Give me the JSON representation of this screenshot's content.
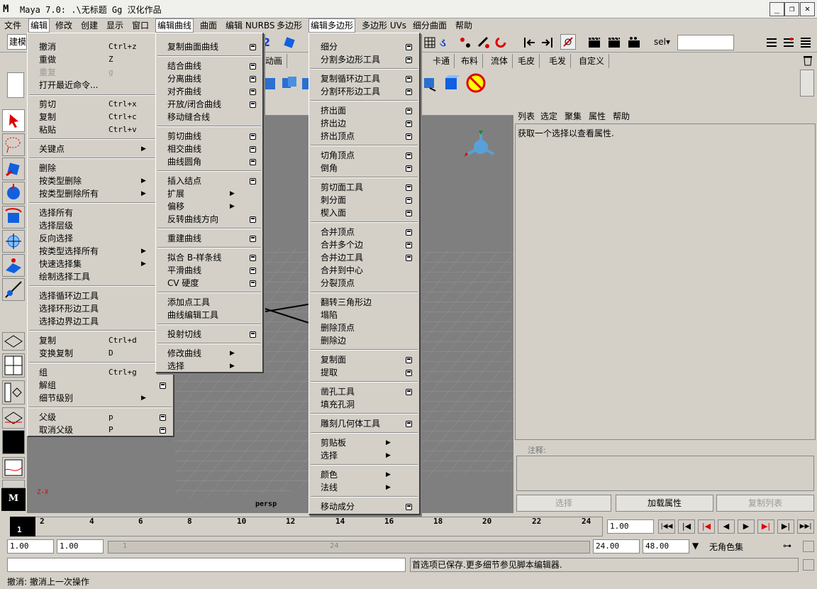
{
  "window": {
    "title": "Maya 7.0: .\\无标题 Gg 汉化作品",
    "minimize": "_",
    "maximize": "❐",
    "close": "✕"
  },
  "menubar": [
    "文件",
    "编辑",
    "修改",
    "创建",
    "显示",
    "窗口",
    "编辑曲线",
    "曲面",
    "编辑 NURBS",
    "多边形",
    "编辑多边形",
    "多边形 UVs",
    "细分曲面",
    "帮助"
  ],
  "toolbar": {
    "mode_dropdown": "建模",
    "sel_label": "sel▾",
    "sel_value": ""
  },
  "shelf_tabs": [
    "动画",
    "卡通",
    "布料",
    "流体",
    "毛皮",
    "毛发",
    "自定义"
  ],
  "viewport": {
    "camera_label": "persp",
    "axis_label": "Z-X"
  },
  "attribute_panel": {
    "menu": [
      "列表",
      "选定",
      "聚集",
      "属性",
      "帮助"
    ],
    "message": "获取一个选择以查看属性.",
    "notes_label": "注释:",
    "buttons": {
      "select": "选择",
      "load": "加载属性",
      "copy_tab": "复制列表"
    }
  },
  "edit_menu": {
    "items": [
      {
        "label": "撤消",
        "shortcut": "Ctrl+z"
      },
      {
        "label": "重做",
        "shortcut": "Z"
      },
      {
        "label": "重复",
        "shortcut": "g",
        "disabled": true
      },
      {
        "label": "打开最近命令..."
      },
      {
        "label": "剪切",
        "shortcut": "Ctrl+x"
      },
      {
        "label": "复制",
        "shortcut": "Ctrl+c"
      },
      {
        "label": "粘贴",
        "shortcut": "Ctrl+v"
      },
      {
        "label": "关键点"
      },
      {
        "label": "删除"
      },
      {
        "label": "按类型删除"
      },
      {
        "label": "按类型删除所有"
      },
      {
        "label": "选择所有"
      },
      {
        "label": "选择层级"
      },
      {
        "label": "反向选择"
      },
      {
        "label": "按类型选择所有"
      },
      {
        "label": "快速选择集"
      },
      {
        "label": "绘制选择工具"
      },
      {
        "label": "选择循环边工具"
      },
      {
        "label": "选择环形边工具"
      },
      {
        "label": "选择边界边工具"
      },
      {
        "label": "复制",
        "shortcut": "Ctrl+d"
      },
      {
        "label": "变换复制",
        "shortcut": "D"
      },
      {
        "label": "组",
        "shortcut": "Ctrl+g"
      },
      {
        "label": "解组"
      },
      {
        "label": "细节级别"
      },
      {
        "label": "父级",
        "shortcut": "p"
      },
      {
        "label": "取消父级",
        "shortcut": "P"
      }
    ]
  },
  "curve_menu": {
    "items": [
      "复制曲面曲线",
      "结合曲线",
      "分离曲线",
      "对齐曲线",
      "开放/闭合曲线",
      "移动缝合线",
      "剪切曲线",
      "相交曲线",
      "曲线圆角",
      "插入结点",
      "扩展",
      "偏移",
      "反转曲线方向",
      "重建曲线",
      "拟合 B-样条线",
      "平滑曲线",
      "CV 硬度",
      "添加点工具",
      "曲线编辑工具",
      "投射切线",
      "修改曲线",
      "选择"
    ]
  },
  "poly_menu": {
    "items": [
      "细分",
      "分割多边形工具",
      "复制循环边工具",
      "分割环形边工具",
      "挤出面",
      "挤出边",
      "挤出顶点",
      "切角顶点",
      "倒角",
      "剪切面工具",
      "刺分面",
      "楔入面",
      "合并顶点",
      "合并多个边",
      "合并边工具",
      "合并到中心",
      "分裂顶点",
      "翻转三角形边",
      "塌陷",
      "删除顶点",
      "删除边",
      "复制面",
      "提取",
      "凿孔工具",
      "填充孔洞",
      "雕刻几何体工具",
      "剪贴板",
      "选择",
      "颜色",
      "法线",
      "移动成分"
    ]
  },
  "timeline": {
    "ticks": [
      "1",
      "2",
      "4",
      "6",
      "8",
      "10",
      "12",
      "14",
      "16",
      "18",
      "20",
      "22",
      "24"
    ],
    "current": "1.00"
  },
  "range": {
    "start": "1.00",
    "inner_start": "1.00",
    "slider_min": "1",
    "slider_max": "24",
    "end_inner": "24.00",
    "end": "48.00",
    "character_set": "无角色集"
  },
  "command_line": {
    "input": "",
    "feedback": "首选项已保存.更多细节参见脚本编辑器."
  },
  "help_line": "撤消: 撤消上一次操作"
}
